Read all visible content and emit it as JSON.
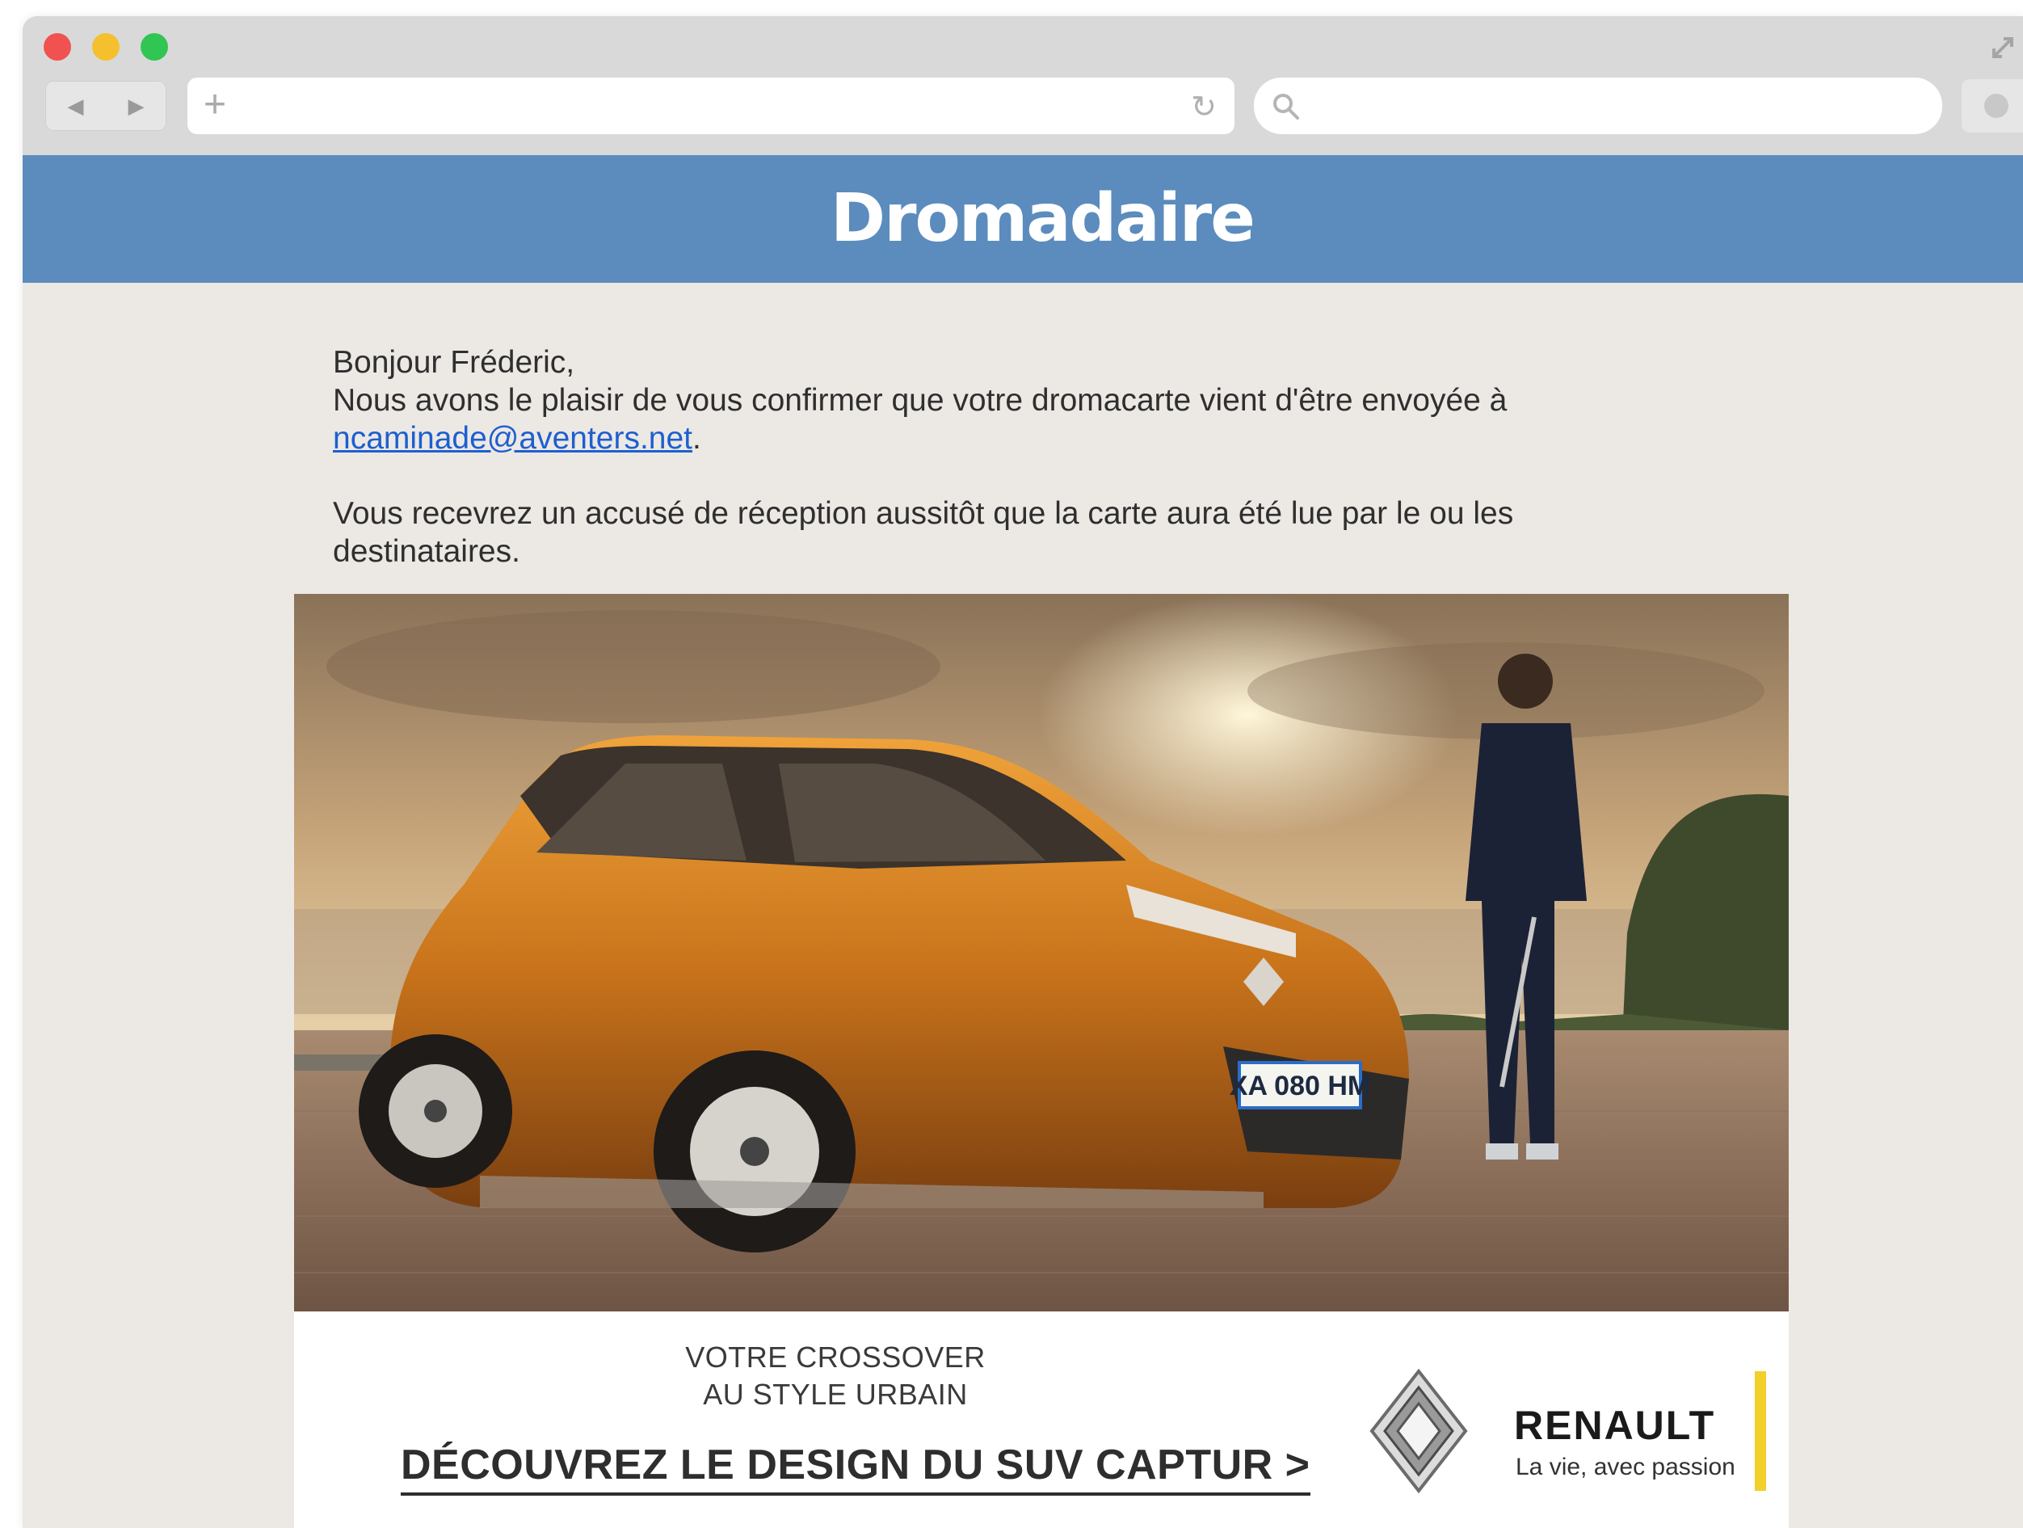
{
  "browser": {
    "url": "",
    "search_placeholder": ""
  },
  "header": {
    "logo_text": "Dromadaire",
    "bg_color": "#5b8cbd"
  },
  "message": {
    "greeting": "Bonjour Fréderic,",
    "line1": "Nous avons le plaisir de vous confirmer que votre dromacarte vient d'être envoyée à",
    "email": "ncaminade@aventers.net",
    "email_suffix": ".",
    "line2": "Vous recevrez un accusé de réception aussitôt que la carte aura été lue par le ou les destinataires."
  },
  "ad": {
    "tagline_line1": "VOTRE CROSSOVER",
    "tagline_line2": "AU STYLE URBAIN",
    "cta": "DÉCOUVREZ LE DESIGN DU SUV CAPTUR >",
    "brand": "RENAULT",
    "slogan": "La vie, avec passion",
    "plate": "XA 080 HM",
    "accent_color": "#f2cf2a"
  }
}
